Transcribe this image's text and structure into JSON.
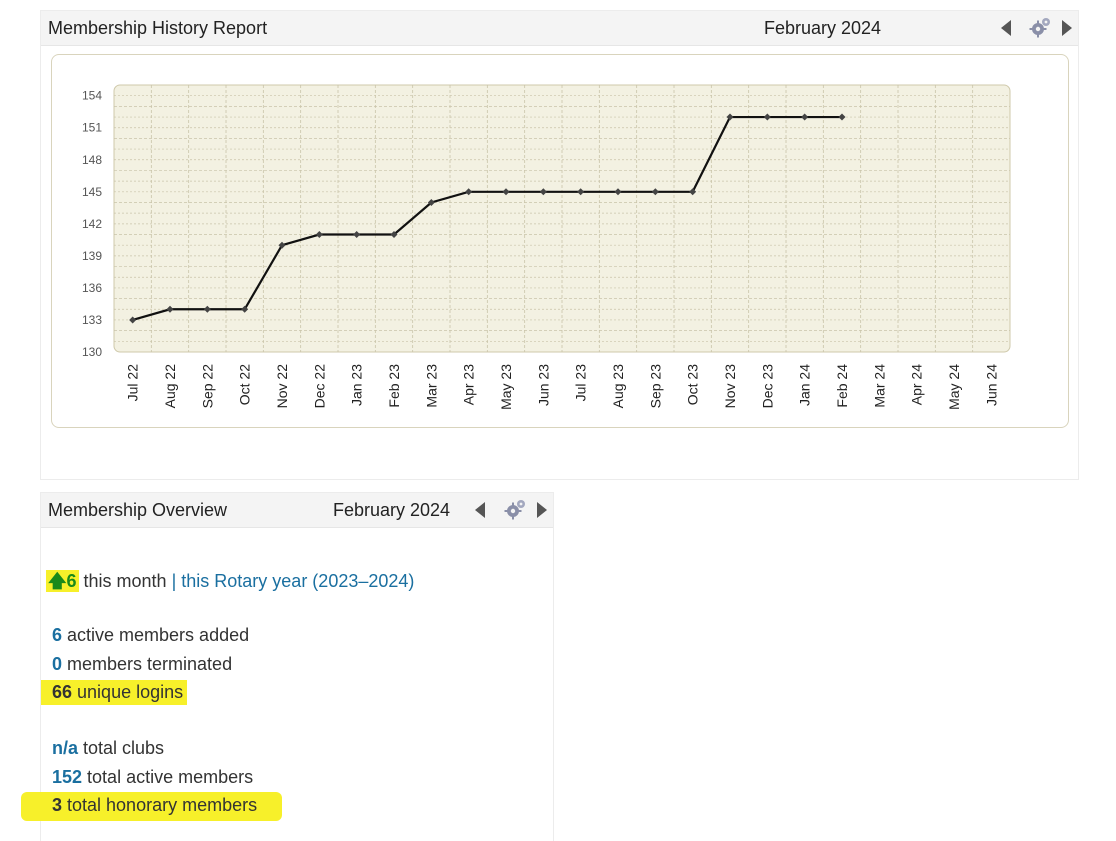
{
  "history": {
    "title": "Membership History Report",
    "month": "February 2024"
  },
  "overview": {
    "title": "Membership Overview",
    "month": "February 2024",
    "change_value": "6",
    "change_suffix": " this month",
    "separator": " | ",
    "rotary_year_link": "this Rotary year (2023–2024)",
    "stats": [
      {
        "value": "6",
        "label": " active members added"
      },
      {
        "value": "0",
        "label": " members terminated"
      },
      {
        "value": "66",
        "label": " unique logins"
      },
      {
        "value": "n/a",
        "label": " total clubs"
      },
      {
        "value": "152",
        "label": " total active members"
      },
      {
        "value": "3",
        "label": " total honorary members"
      }
    ]
  },
  "colors": {
    "plot_background": "#f3f1e2",
    "grid_line": "#c9c4a9",
    "line": "#111111",
    "highlight": "#f7f02a",
    "link": "#1a6fa0"
  },
  "icons": [
    "chevron-left-icon",
    "gear-icon",
    "chevron-right-icon",
    "up-arrow-icon"
  ],
  "chart_data": {
    "type": "line",
    "x": [
      "Jul 22",
      "Aug 22",
      "Sep 22",
      "Oct 22",
      "Nov 22",
      "Dec 22",
      "Jan 23",
      "Feb 23",
      "Mar 23",
      "Apr 23",
      "May 23",
      "Jun 23",
      "Jul 23",
      "Aug 23",
      "Sep 23",
      "Oct 23",
      "Nov 23",
      "Dec 23",
      "Jan 24",
      "Feb 24",
      "Mar 24",
      "Apr 24",
      "May 24",
      "Jun 24"
    ],
    "series": [
      {
        "values": [
          133,
          134,
          134,
          134,
          140,
          141,
          141,
          141,
          144,
          145,
          145,
          145,
          145,
          145,
          145,
          145,
          152,
          152,
          152,
          152
        ]
      }
    ],
    "y_ticks": [
      130,
      133,
      136,
      139,
      142,
      145,
      148,
      151,
      154
    ],
    "ylim": [
      130,
      155
    ],
    "grid": true,
    "legend": "none"
  }
}
